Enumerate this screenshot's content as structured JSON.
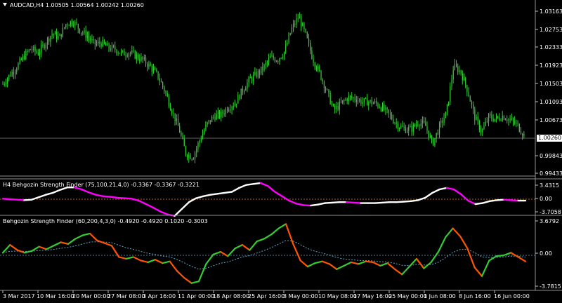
{
  "symbol_header": "AUDCAD,H4  1.00505 1.00564 1.00242 1.00260",
  "current_price": "1.00260",
  "main_price_labels": [
    "1.03163",
    "1.02753",
    "1.02333",
    "1.01923",
    "1.01503",
    "1.01093",
    "1.00673",
    "0.99843",
    "0.99433"
  ],
  "ind1": {
    "title": "H4 Behgozin Strength Finder (75,100,21,4,0) -0.3367 -0.3367 -0.3221",
    "labels": [
      "3.4315",
      "0.00",
      "-3.7058"
    ]
  },
  "ind2": {
    "title": "Behgozin Strength Finder (60,200,4,3,0) -0.4920 -0.4920 0.1020 -0.3003",
    "labels": [
      "3.6792",
      "0.00",
      "-3.7815"
    ]
  },
  "time_labels": [
    "3 Mar 2017",
    "10 Mar 16:00",
    "20 Mar 00:00",
    "27 Mar 08:00",
    "3 Apr 16:00",
    "11 Apr 00:00",
    "18 Apr 08:00",
    "25 Apr 16:00",
    "3 May 00:00",
    "10 May 08:00",
    "17 May 16:00",
    "25 May 00:00",
    "1 Jun 08:00",
    "8 Jun 16:00",
    "16 Jun 00:00"
  ],
  "colors": {
    "candle": "#33cc33",
    "grid_line": "#c0c0c0",
    "sep": "#808080",
    "ind1_up": "#ffffff",
    "ind1_dn": "#ff00ff",
    "ind1_zero": "#ff8000",
    "ind2_up": "#33cc33",
    "ind2_dn": "#ff5500",
    "ind2_sig": "#5fa8c8"
  },
  "chart_data": {
    "type": "candlestick",
    "price_series": [
      1.0151,
      1.0172,
      1.0191,
      1.0215,
      1.0233,
      1.0222,
      1.0245,
      1.0268,
      1.0258,
      1.0291,
      1.0296,
      1.0275,
      1.0262,
      1.0243,
      1.0246,
      1.0235,
      1.0231,
      1.0221,
      1.0225,
      1.0215,
      1.0205,
      1.019,
      1.017,
      1.0135,
      1.009,
      1.0048,
      0.999,
      0.9982,
      1.0023,
      1.0058,
      1.0077,
      1.008,
      1.0098,
      1.0107,
      1.0136,
      1.016,
      1.0173,
      1.0188,
      1.0212,
      1.0208,
      1.0226,
      1.0278,
      1.0307,
      1.0264,
      1.021,
      1.0176,
      1.0134,
      1.009,
      1.0105,
      1.012,
      1.0118,
      1.011,
      1.011,
      1.0106,
      1.0094,
      1.0077,
      1.0057,
      1.0047,
      1.0047,
      1.0063,
      1.0055,
      1.0012,
      1.0052,
      1.0085,
      1.0192,
      1.018,
      1.0136,
      1.0075,
      1.004,
      1.0075,
      1.007,
      1.0077,
      1.0068,
      1.0057,
      1.0033
    ],
    "ind1_series": [
      0.1,
      0.0,
      -0.1,
      -0.2,
      -0.1,
      0.4,
      0.9,
      1.3,
      1.9,
      2.4,
      2.4,
      2.0,
      1.4,
      0.9,
      0.6,
      0.5,
      0.3,
      0.2,
      0.1,
      -0.3,
      -1.0,
      -1.7,
      -2.5,
      -3.1,
      -3.4,
      -2.0,
      -0.6,
      0.2,
      0.6,
      0.9,
      1.1,
      1.3,
      1.5,
      2.3,
      2.9,
      3.1,
      3.3,
      2.7,
      1.5,
      0.6,
      -0.3,
      -0.9,
      -1.2,
      -1.3,
      -1.1,
      -0.8,
      -0.7,
      -0.6,
      -0.6,
      -0.7,
      -0.8,
      -0.8,
      -0.8,
      -0.7,
      -0.6,
      -0.6,
      -0.5,
      -0.4,
      -0.2,
      0.3,
      1.3,
      2.0,
      2.3,
      2.0,
      1.0,
      -0.3,
      -1.0,
      -0.8,
      -0.4,
      -0.2,
      -0.1,
      -0.2,
      -0.3,
      -0.3
    ],
    "ind2_series": [
      0.3,
      1.2,
      0.6,
      0.3,
      0.5,
      1.0,
      0.7,
      1.1,
      1.5,
      1.3,
      1.9,
      2.3,
      2.5,
      1.7,
      1.4,
      1.1,
      -0.2,
      -0.4,
      -0.2,
      -0.6,
      -0.8,
      -0.5,
      -0.9,
      -0.7,
      -1.8,
      -2.6,
      -3.2,
      -3.0,
      -1.0,
      0.1,
      0.4,
      -0.1,
      0.8,
      1.2,
      0.6,
      1.6,
      1.9,
      2.4,
      3.1,
      3.6,
      1.3,
      -0.6,
      -1.3,
      -0.9,
      -0.7,
      -1.0,
      -1.6,
      -1.2,
      -0.8,
      -1.0,
      -0.7,
      -0.8,
      -1.2,
      -0.9,
      -1.6,
      -2.2,
      -1.3,
      -0.4,
      -1.5,
      -0.8,
      0.4,
      2.1,
      3.1,
      2.2,
      0.8,
      -1.4,
      -2.4,
      -0.6,
      -0.1,
      0.0,
      0.3,
      -0.2,
      -0.7
    ]
  }
}
